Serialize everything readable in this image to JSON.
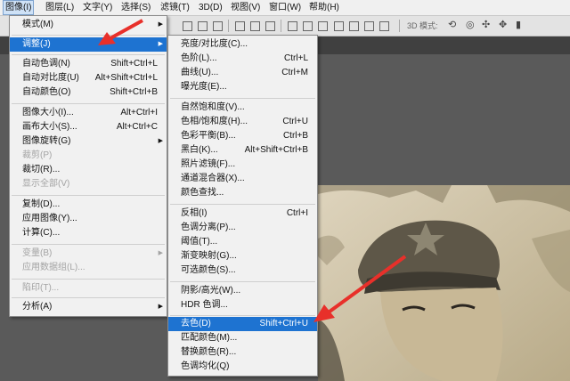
{
  "menubar": {
    "items": [
      "图像(I)",
      "图层(L)",
      "文字(Y)",
      "选择(S)",
      "滤镜(T)",
      "3D(D)",
      "视图(V)",
      "窗口(W)",
      "帮助(H)"
    ],
    "mode3d_label": "3D 模式:"
  },
  "image_menu": {
    "items": [
      {
        "label": "模式(M)",
        "shortcut": "",
        "submenu": true
      },
      {
        "label": "调整(J)",
        "shortcut": "",
        "submenu": true
      },
      {
        "label": "自动色调(N)",
        "shortcut": "Shift+Ctrl+L"
      },
      {
        "label": "自动对比度(U)",
        "shortcut": "Alt+Shift+Ctrl+L"
      },
      {
        "label": "自动颜色(O)",
        "shortcut": "Shift+Ctrl+B"
      },
      {
        "label": "图像大小(I)...",
        "shortcut": "Alt+Ctrl+I"
      },
      {
        "label": "画布大小(S)...",
        "shortcut": "Alt+Ctrl+C"
      },
      {
        "label": "图像旋转(G)",
        "shortcut": "",
        "submenu": true
      },
      {
        "label": "裁剪(P)",
        "shortcut": ""
      },
      {
        "label": "裁切(R)...",
        "shortcut": ""
      },
      {
        "label": "显示全部(V)",
        "shortcut": ""
      },
      {
        "label": "复制(D)...",
        "shortcut": ""
      },
      {
        "label": "应用图像(Y)...",
        "shortcut": ""
      },
      {
        "label": "计算(C)...",
        "shortcut": ""
      },
      {
        "label": "变量(B)",
        "shortcut": "",
        "submenu": true
      },
      {
        "label": "应用数据组(L)...",
        "shortcut": ""
      },
      {
        "label": "陷印(T)...",
        "shortcut": ""
      },
      {
        "label": "分析(A)",
        "shortcut": "",
        "submenu": true
      }
    ]
  },
  "adjust_menu": {
    "items": [
      {
        "label": "亮度/对比度(C)...",
        "shortcut": ""
      },
      {
        "label": "色阶(L)...",
        "shortcut": "Ctrl+L"
      },
      {
        "label": "曲线(U)...",
        "shortcut": "Ctrl+M"
      },
      {
        "label": "曝光度(E)...",
        "shortcut": ""
      },
      {
        "label": "自然饱和度(V)...",
        "shortcut": ""
      },
      {
        "label": "色相/饱和度(H)...",
        "shortcut": "Ctrl+U"
      },
      {
        "label": "色彩平衡(B)...",
        "shortcut": "Ctrl+B"
      },
      {
        "label": "黑白(K)...",
        "shortcut": "Alt+Shift+Ctrl+B"
      },
      {
        "label": "照片滤镜(F)...",
        "shortcut": ""
      },
      {
        "label": "通道混合器(X)...",
        "shortcut": ""
      },
      {
        "label": "颜色查找...",
        "shortcut": ""
      },
      {
        "label": "反相(I)",
        "shortcut": "Ctrl+I"
      },
      {
        "label": "色调分离(P)...",
        "shortcut": ""
      },
      {
        "label": "阈值(T)...",
        "shortcut": ""
      },
      {
        "label": "渐变映射(G)...",
        "shortcut": ""
      },
      {
        "label": "可选颜色(S)...",
        "shortcut": ""
      },
      {
        "label": "阴影/高光(W)...",
        "shortcut": ""
      },
      {
        "label": "HDR 色调...",
        "shortcut": ""
      },
      {
        "label": "去色(D)",
        "shortcut": "Shift+Ctrl+U"
      },
      {
        "label": "匹配颜色(M)...",
        "shortcut": ""
      },
      {
        "label": "替换颜色(R)...",
        "shortcut": ""
      },
      {
        "label": "色调均化(Q)",
        "shortcut": ""
      }
    ]
  },
  "colors": {
    "highlight": "#1e73d1",
    "arrow": "#e8302a",
    "menu_bg": "#f1f1f1"
  }
}
